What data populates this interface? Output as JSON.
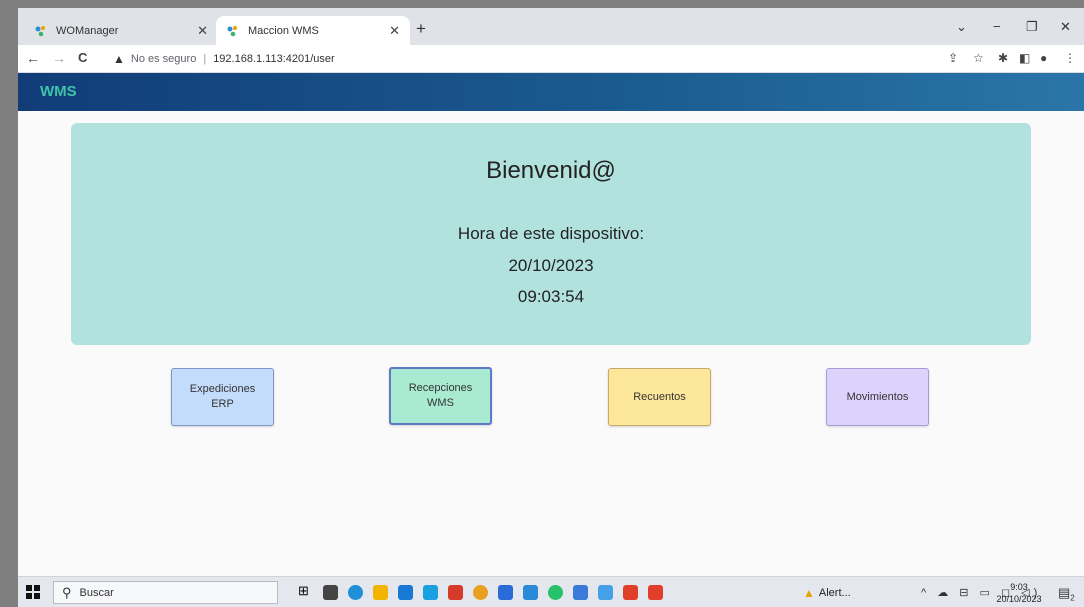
{
  "browser": {
    "tabs": [
      {
        "title": "WOManager",
        "active": false
      },
      {
        "title": "Maccion WMS",
        "active": true
      }
    ],
    "new_tab": "+",
    "window_controls": {
      "chevron": "⌄",
      "minimize": "−",
      "restore": "❐",
      "close": "✕"
    },
    "nav": {
      "back": "←",
      "forward": "→",
      "reload": "C"
    },
    "address": {
      "security_text": "No es seguro",
      "url": "192.168.1.113:4201/user"
    }
  },
  "app": {
    "title": "WMS",
    "header_colors": [
      "#113c78",
      "#2a75a8"
    ],
    "accent": "#3ec4a8"
  },
  "welcome": {
    "greeting": "Bienvenid@",
    "time_label": "Hora de este dispositivo:",
    "date": "20/10/2023",
    "time": "09:03:54"
  },
  "actions": [
    {
      "label_line1": "Expediciones",
      "label_line2": "ERP",
      "color": "#c4dcfb"
    },
    {
      "label_line1": "Recepciones",
      "label_line2": "WMS",
      "color": "#a9ebd2"
    },
    {
      "label_line1": "Recuentos",
      "label_line2": "",
      "color": "#fde79a"
    },
    {
      "label_line1": "Movimientos",
      "label_line2": "",
      "color": "#ddd2fc"
    }
  ],
  "taskbar": {
    "search_placeholder": "Buscar",
    "alert_label": "Alert...",
    "clock_time": "9:03",
    "clock_date": "20/10/2023",
    "notification_count": "2"
  }
}
